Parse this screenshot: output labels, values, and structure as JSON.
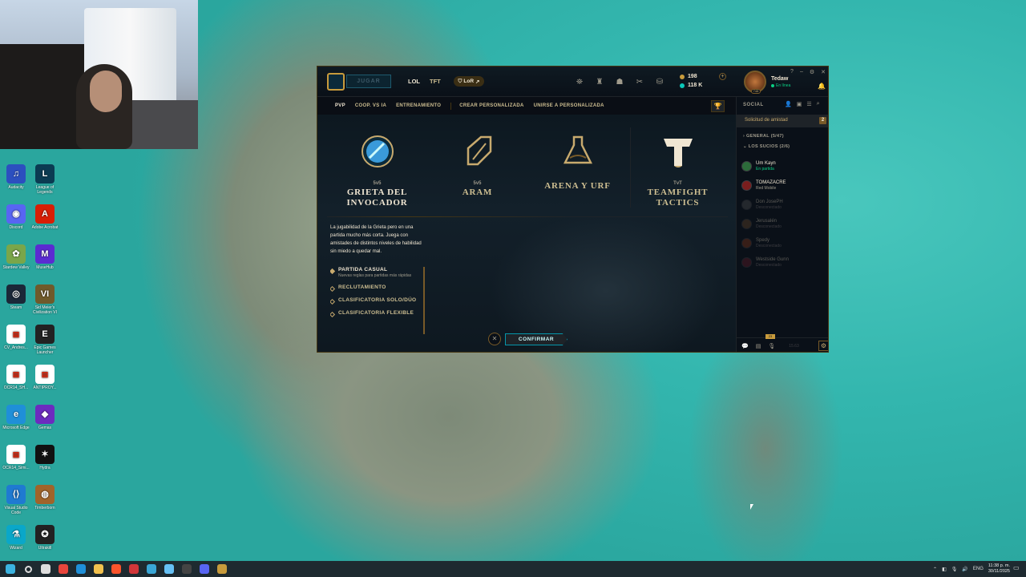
{
  "desktop": {
    "icons": [
      {
        "label": "Audacity",
        "color": "#2c4fbf",
        "glyph": "♫"
      },
      {
        "label": "League of Legends",
        "color": "#0b3b52",
        "glyph": "L"
      },
      {
        "label": "Discord",
        "color": "#5865f2",
        "glyph": "◉"
      },
      {
        "label": "Adobe Acrobat",
        "color": "#d81e05",
        "glyph": "A"
      },
      {
        "label": "Stardew Valley",
        "color": "#7aa64a",
        "glyph": "✿"
      },
      {
        "label": "MuseHub",
        "color": "#5b2bd1",
        "glyph": "M"
      },
      {
        "label": "Steam",
        "color": "#1b2838",
        "glyph": "◎"
      },
      {
        "label": "Sid Meier's Civilization VI",
        "color": "#6f5a2b",
        "glyph": "VI"
      },
      {
        "label": "CV_Andres...",
        "color": "#ffffff",
        "glyph": "▤"
      },
      {
        "label": "Epic Games Launcher",
        "color": "#222222",
        "glyph": "E"
      },
      {
        "label": "OCR14_SH...",
        "color": "#ffffff",
        "glyph": "▤"
      },
      {
        "label": "ANTIPROY...",
        "color": "#ffffff",
        "glyph": "▤"
      },
      {
        "label": "Microsoft Edge",
        "color": "#1f8fd8",
        "glyph": "e"
      },
      {
        "label": "Gemas",
        "color": "#6c2bbf",
        "glyph": "◆"
      },
      {
        "label": "OCR14_Simi...",
        "color": "#ffffff",
        "glyph": "▤"
      },
      {
        "label": "Hydra",
        "color": "#111111",
        "glyph": "✶"
      },
      {
        "label": "Visual Studio Code",
        "color": "#1f7ad1",
        "glyph": "⟨⟩"
      },
      {
        "label": "Timberborn",
        "color": "#a0642a",
        "glyph": "◍"
      },
      {
        "label": "Wizard",
        "color": "#0aa7c9",
        "glyph": "⚗"
      },
      {
        "label": "Ultrakill",
        "color": "#222222",
        "glyph": "✪"
      }
    ],
    "taskbar_apps": [
      {
        "name": "start",
        "color": "#3bb3e0"
      },
      {
        "name": "search",
        "color": "#dddddd"
      },
      {
        "name": "task-view",
        "color": "#dddddd"
      },
      {
        "name": "chrome",
        "color": "#e8453c"
      },
      {
        "name": "edge",
        "color": "#1f8fd8"
      },
      {
        "name": "explorer",
        "color": "#f2c14e"
      },
      {
        "name": "brave",
        "color": "#fb542b"
      },
      {
        "name": "riot",
        "color": "#d13639"
      },
      {
        "name": "files",
        "color": "#3aa6d6"
      },
      {
        "name": "steam",
        "color": "#66c0f4"
      },
      {
        "name": "obs",
        "color": "#444444"
      },
      {
        "name": "discord",
        "color": "#5865f2"
      },
      {
        "name": "league",
        "color": "#c89b3c"
      }
    ],
    "tray": {
      "time": "11:38 p. m.",
      "date": "30/11/2025",
      "lang": "ENG"
    }
  },
  "client": {
    "play_label": "JUGAR",
    "nav": {
      "lol": "LOL",
      "tft": "TFT",
      "lor": "LoR"
    },
    "currency": {
      "rp": "198",
      "be": "118 K"
    },
    "user": {
      "name": "Tedaw",
      "status": "En línea",
      "level": "748"
    },
    "subnav": {
      "pvp": "PVP",
      "coop": "COOP. VS IA",
      "training": "ENTRENAMIENTO",
      "create_custom": "CREAR PERSONALIZADA",
      "join_custom": "UNIRSE A PERSONALIZADA"
    },
    "modes": [
      {
        "sub": "5v5",
        "title": "GRIETA DEL INVOCADOR",
        "color": "#3a9ad9"
      },
      {
        "sub": "5v5",
        "title": "ARAM",
        "color": "#c8aa6e"
      },
      {
        "sub": "",
        "title": "ARENA Y URF",
        "color": "#c8aa6e"
      },
      {
        "sub": "TvT",
        "title": "TEAMFIGHT TACTICS",
        "color": "#f0e6d2"
      }
    ],
    "description": "La jugabilidad de la Grieta pero en una partida mucho más corta. Juega con amistades de distintos niveles de habilidad sin miedo a quedar mal.",
    "queues": [
      {
        "label": "PARTIDA CASUAL",
        "desc": "Nuevas reglas para partidas más rápidas"
      },
      {
        "label": "RECLUTAMIENTO",
        "desc": ""
      },
      {
        "label": "CLASIFICATORIA SOLO/DÚO",
        "desc": ""
      },
      {
        "label": "CLASIFICATORIA FLEXIBLE",
        "desc": ""
      }
    ],
    "confirm_label": "CONFIRMAR",
    "social": {
      "title": "SOCIAL",
      "friend_request": "Solicitud de amistad",
      "friend_request_count": "2",
      "group_general": "GENERAL (5/47)",
      "group_sucios": "LOS SUCIOS (2/6)",
      "friends": [
        {
          "name": "Um Kayn",
          "status": "En partida",
          "color": "#0acf83",
          "avatar": "#2c6b3a",
          "online": true
        },
        {
          "name": "TOMAZACRE",
          "status": "Red Mobile",
          "color": "#a09b8c",
          "avatar": "#7a1e1e",
          "online": true
        },
        {
          "name": "Don JosePH",
          "status": "Desconectado",
          "color": "#3c3c41",
          "avatar": "#555555",
          "online": false
        },
        {
          "name": "Jerusalén",
          "status": "Desconectado",
          "color": "#3c3c41",
          "avatar": "#6b4a2a",
          "online": false
        },
        {
          "name": "Spedy",
          "status": "Desconectado",
          "color": "#3c3c41",
          "avatar": "#8a3a1a",
          "online": false
        },
        {
          "name": "Westside Gunn",
          "status": "Desconectado",
          "color": "#3c3c41",
          "avatar": "#6b1e2a",
          "online": false
        }
      ],
      "footer_badge": "23",
      "version": "15.63"
    }
  }
}
